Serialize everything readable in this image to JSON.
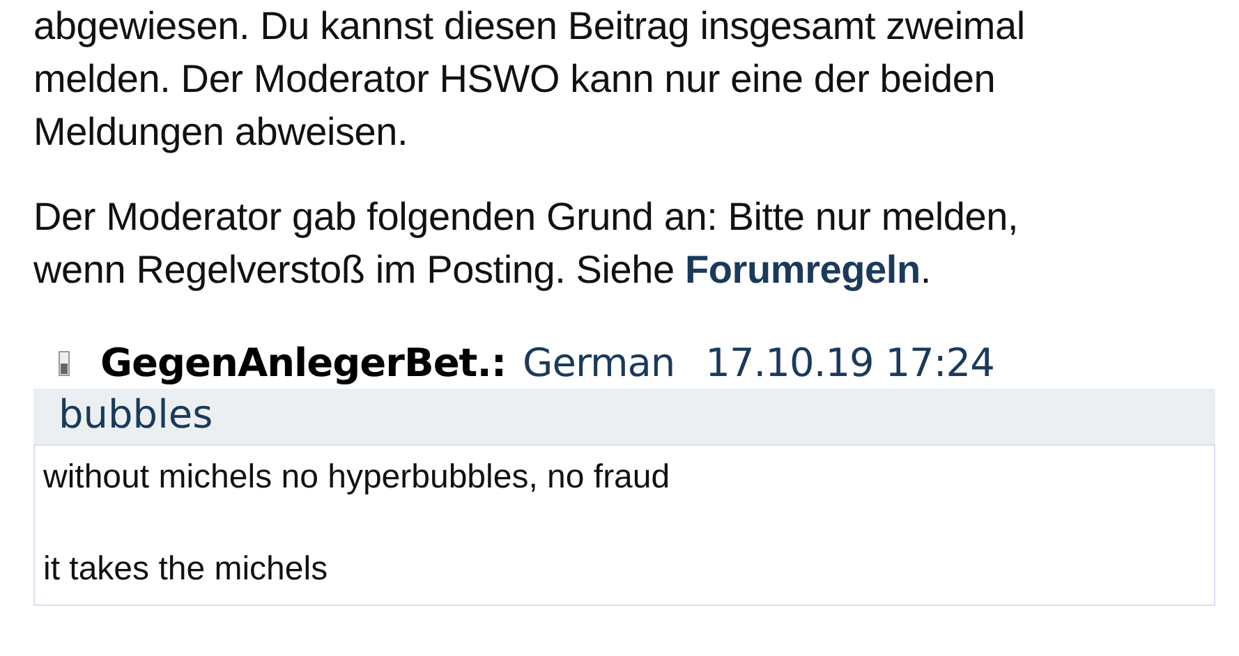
{
  "notice": {
    "lines": [
      "abgewiesen. Du kannst diesen Beitrag insgesamt zweimal",
      "melden. Der Moderator HSWO kann nur eine der beiden",
      "Meldungen abweisen."
    ]
  },
  "reason": {
    "lines": [
      "Der Moderator gab folgenden Grund an: Bitte nur melden,",
      "wenn Regelverstoß im Posting. Siehe "
    ],
    "link": "Forumregeln",
    "after": "."
  },
  "post": {
    "author": "GegenAnlegerBet.:",
    "language": "German",
    "date": "17.10.19 17:24",
    "subject": "bubbles",
    "body": [
      "without michels no hyperbubbles, no fraud",
      "it takes the michels"
    ]
  }
}
